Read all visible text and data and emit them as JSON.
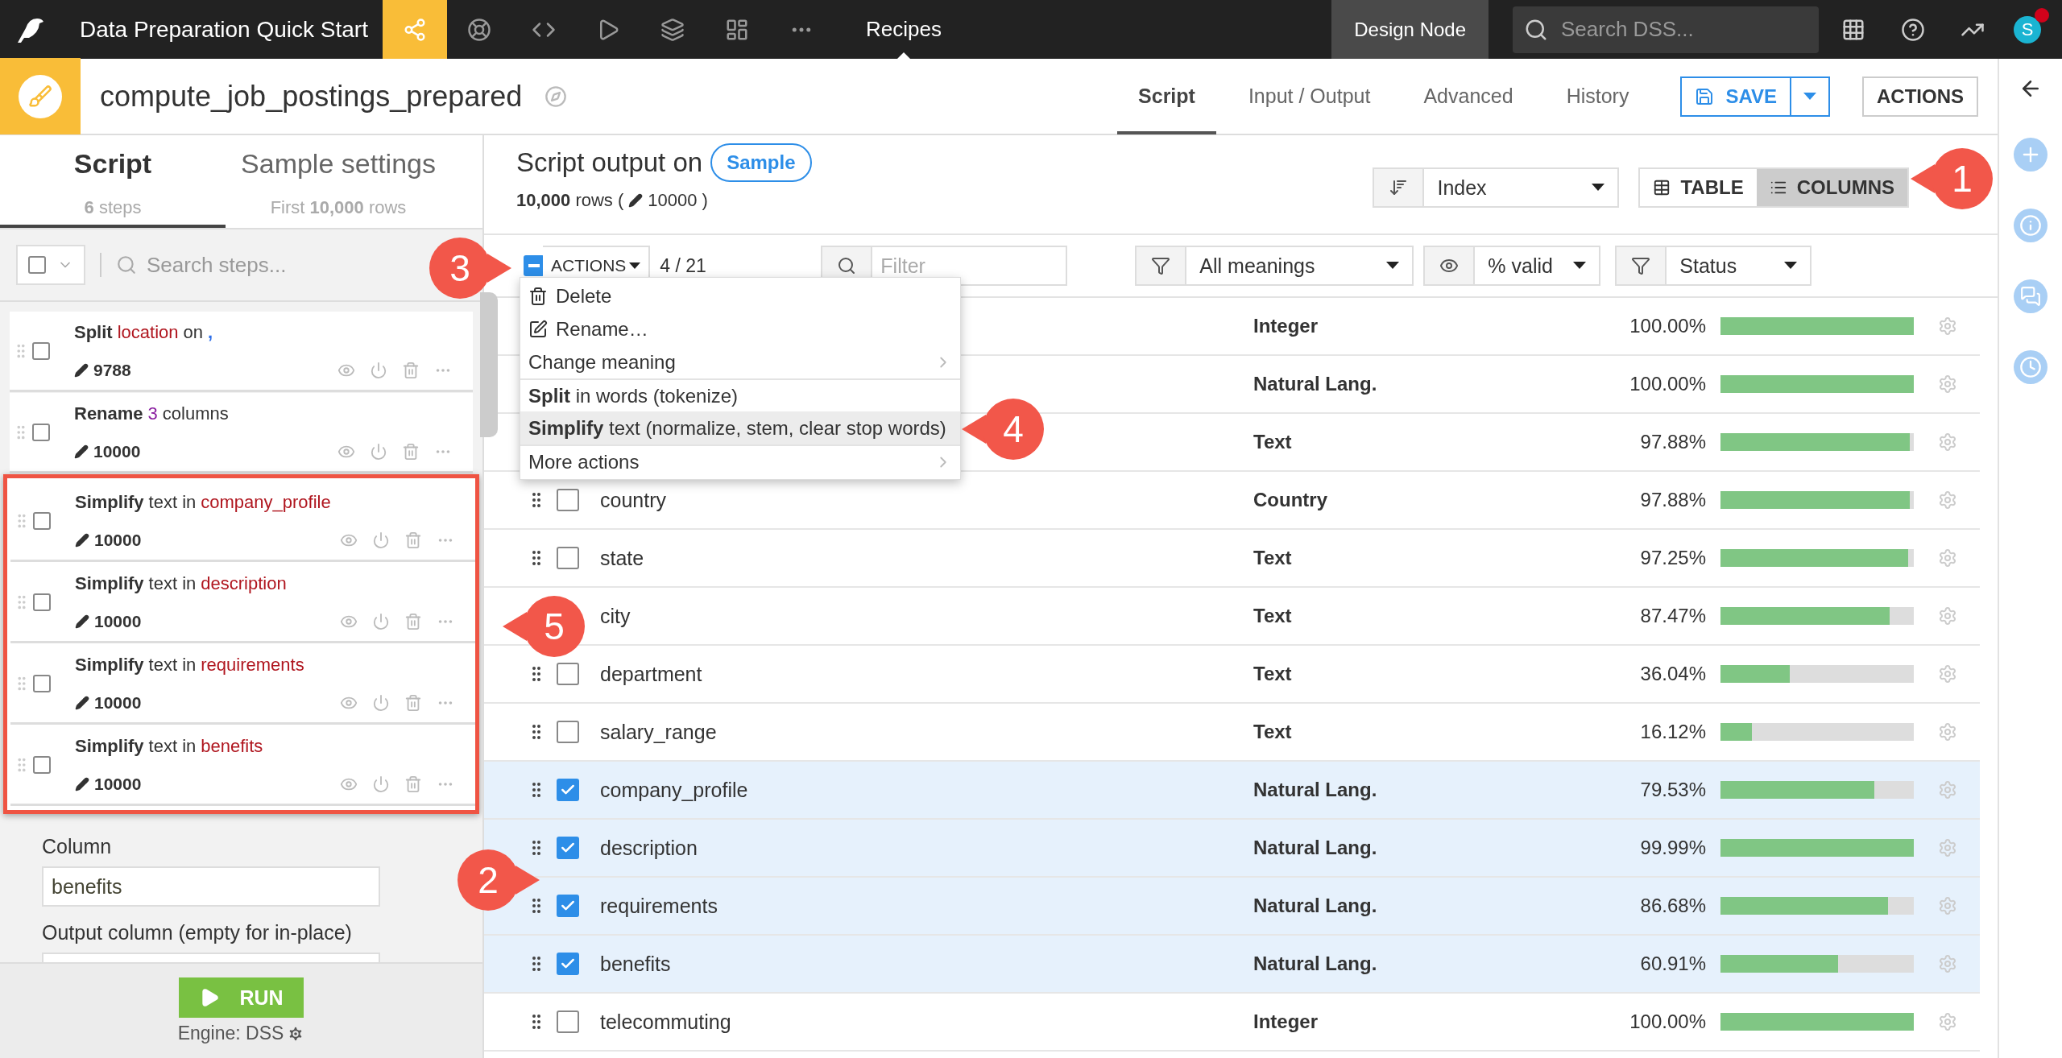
{
  "top_bar": {
    "project_title": "Data Preparation Quick Start",
    "nav": [
      {
        "kind": "flow",
        "selected": true
      },
      {
        "kind": "lab",
        "selected": false
      },
      {
        "kind": "code",
        "selected": false
      },
      {
        "kind": "run",
        "selected": false
      },
      {
        "kind": "stack",
        "selected": false
      },
      {
        "kind": "dashboard",
        "selected": false
      },
      {
        "kind": "more",
        "selected": false
      }
    ],
    "section": "Recipes",
    "node": "Design Node",
    "search": {
      "placeholder": "Search DSS..."
    },
    "avatar": "S",
    "notification": true
  },
  "header": {
    "recipe_name": "compute_job_postings_prepared",
    "tabs": [
      {
        "label": "Script",
        "selected": true
      },
      {
        "label": "Input / Output",
        "selected": false
      },
      {
        "label": "Advanced",
        "selected": false
      },
      {
        "label": "History",
        "selected": false
      }
    ],
    "save": "SAVE",
    "actions": "ACTIONS"
  },
  "left_panel": {
    "tabs": [
      {
        "label": "Script",
        "subtitle": "**6** steps",
        "selected": true
      },
      {
        "label": "Sample settings",
        "subtitle": "First **10,000** rows",
        "selected": false
      }
    ],
    "select_all": {
      "checked": false
    },
    "search": {
      "placeholder": "Search steps..."
    },
    "steps": [
      {
        "segments": [
          {
            "text": "Split",
            "kind": "verb"
          },
          {
            "text": "location",
            "kind": "column"
          },
          {
            "text": "on",
            "kind": "plain"
          },
          {
            "text": ",",
            "kind": "separator"
          }
        ],
        "count": "9788",
        "checked": false
      },
      {
        "segments": [
          {
            "text": "Rename",
            "kind": "verb"
          },
          {
            "text": "3",
            "kind": "number"
          },
          {
            "text": "columns",
            "kind": "plain"
          }
        ],
        "count": "10000",
        "checked": false
      }
    ],
    "highlighted_steps": [
      {
        "segments": [
          {
            "text": "Simplify",
            "kind": "verb"
          },
          {
            "text": "text in",
            "kind": "plain"
          },
          {
            "text": "company_profile",
            "kind": "column"
          }
        ],
        "count": "10000",
        "checked": false
      },
      {
        "segments": [
          {
            "text": "Simplify",
            "kind": "verb"
          },
          {
            "text": "text in",
            "kind": "plain"
          },
          {
            "text": "description",
            "kind": "column"
          }
        ],
        "count": "10000",
        "checked": false
      },
      {
        "segments": [
          {
            "text": "Simplify",
            "kind": "verb"
          },
          {
            "text": "text in",
            "kind": "plain"
          },
          {
            "text": "requirements",
            "kind": "column"
          }
        ],
        "count": "10000",
        "checked": false
      },
      {
        "segments": [
          {
            "text": "Simplify",
            "kind": "verb"
          },
          {
            "text": "text in",
            "kind": "plain"
          },
          {
            "text": "benefits",
            "kind": "column"
          }
        ],
        "count": "10000",
        "checked": false
      }
    ],
    "form": {
      "fields": [
        {
          "label": "Column",
          "value": "benefits"
        },
        {
          "label": "Output column (empty for in-place)"
        }
      ]
    },
    "run": "RUN",
    "engine": "Engine: DSS"
  },
  "main": {
    "title": "Script output on",
    "sample_badge": "Sample",
    "rows_summary": "**10,000** rows (",
    "sample_count": "10000 )",
    "sort": {
      "value": "Index"
    },
    "view_toggle": [
      {
        "label": "TABLE",
        "kind": "table",
        "selected": false
      },
      {
        "label": "COLUMNS",
        "kind": "columns",
        "selected": true
      }
    ],
    "toolbar": {
      "partial_selection": true,
      "actions": "ACTIONS",
      "selection_count": "4 / 21",
      "filter_placeholder": "Filter",
      "meaning_filter": "All meanings",
      "display": "% valid",
      "status_filter": "Status"
    },
    "menu": [
      {
        "label": "Delete",
        "kind": "trash",
        "divider_before": false,
        "selected": false
      },
      {
        "label": "Rename…",
        "kind": "pencil",
        "divider_before": false,
        "selected": false
      },
      {
        "label": "Change meaning",
        "kind": "submenu",
        "divider_before": false,
        "selected": false
      },
      {
        "label": "**Split** in words (tokenize)",
        "kind": "plain",
        "divider_before": true,
        "selected": false
      },
      {
        "label": "**Simplify** text (normalize, stem, clear stop words)",
        "kind": "plain",
        "divider_before": false,
        "selected": true
      },
      {
        "label": "More actions",
        "kind": "submenu",
        "divider_before": true,
        "selected": false
      }
    ],
    "rows": [
      {
        "meaning": "Integer",
        "valid": "100.00%",
        "level": 1.0
      },
      {
        "meaning": "Natural Lang.",
        "valid": "100.00%",
        "level": 1.0
      },
      {
        "meaning": "Text",
        "valid": "97.88%",
        "level": 0.9788
      },
      {
        "name": "country",
        "checked": false,
        "meaning": "Country",
        "valid": "97.88%",
        "level": 0.9788
      },
      {
        "name": "state",
        "checked": false,
        "meaning": "Text",
        "valid": "97.25%",
        "level": 0.9725
      },
      {
        "name": "city",
        "meaning": "Text",
        "valid": "87.47%",
        "level": 0.8747
      },
      {
        "name": "department",
        "checked": false,
        "meaning": "Text",
        "valid": "36.04%",
        "level": 0.3604
      },
      {
        "name": "salary_range",
        "checked": false,
        "meaning": "Text",
        "valid": "16.12%",
        "level": 0.1612
      },
      {
        "name": "company_profile",
        "checked": true,
        "meaning": "Natural Lang.",
        "valid": "79.53%",
        "level": 0.7953
      },
      {
        "name": "description",
        "checked": true,
        "meaning": "Natural Lang.",
        "valid": "99.99%",
        "level": 0.9999
      },
      {
        "name": "requirements",
        "checked": true,
        "meaning": "Natural Lang.",
        "valid": "86.68%",
        "level": 0.8668
      },
      {
        "name": "benefits",
        "checked": true,
        "meaning": "Natural Lang.",
        "valid": "60.91%",
        "level": 0.6091
      },
      {
        "name": "telecommuting",
        "checked": false,
        "meaning": "Integer",
        "valid": "100.00%",
        "level": 1.0
      }
    ]
  },
  "callouts": [
    {
      "label": "1"
    },
    {
      "label": "2"
    },
    {
      "label": "3"
    },
    {
      "label": "4"
    },
    {
      "label": "5"
    }
  ]
}
